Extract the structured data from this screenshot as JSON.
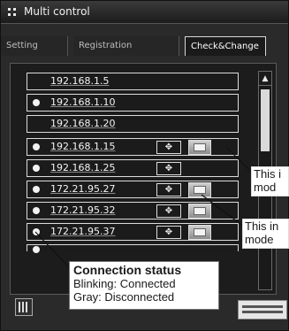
{
  "window": {
    "title": "Multi control"
  },
  "tabs": [
    {
      "label": "Setting",
      "active": false
    },
    {
      "label": "Registration",
      "active": false
    },
    {
      "label": "Check&Change",
      "active": true
    }
  ],
  "rows": [
    {
      "ip": "192.168.1.5",
      "status_dot": false,
      "buttons": false
    },
    {
      "ip": "192.168.1.10",
      "status_dot": true,
      "buttons": false
    },
    {
      "ip": "192.168.1.20",
      "status_dot": false,
      "buttons": false
    },
    {
      "ip": "192.168.1.15",
      "status_dot": true,
      "buttons": true
    },
    {
      "ip": "192.168.1.25",
      "status_dot": true,
      "buttons": true,
      "mode_button": false
    },
    {
      "ip": "172.21.95.27",
      "status_dot": true,
      "buttons": true
    },
    {
      "ip": "172.21.95.32",
      "status_dot": true,
      "buttons": true
    },
    {
      "ip": "172.21.95.37",
      "status_dot": true,
      "buttons": true
    }
  ],
  "callouts": {
    "mode_1": {
      "line1": "This i",
      "line2": "mod"
    },
    "mode_2": {
      "line1": "This in",
      "line2": "mode"
    },
    "connection": {
      "heading": "Connection status",
      "line1": "Blinking: Connected",
      "line2": "Gray: Disconnected"
    }
  },
  "icons": {
    "title": "grip-icon",
    "move": "move-arrows-icon",
    "mode": "mode-icon",
    "status": "status-dot-icon",
    "grid": "grid-view-icon",
    "logo": "brand-logo-icon"
  },
  "colors": {
    "background": "#2a2a2a",
    "panel": "#1c1c1c",
    "text": "#f4f4f4",
    "callout_bg": "#ffffff"
  }
}
